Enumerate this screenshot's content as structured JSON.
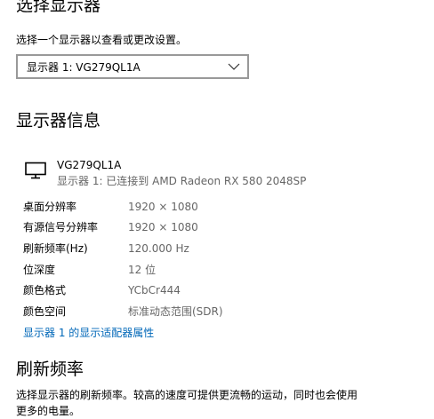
{
  "select_display": {
    "title": "选择显示器",
    "description": "选择一个显示器以查看或更改设置。",
    "dropdown_value": "显示器 1: VG279QL1A"
  },
  "display_info": {
    "title": "显示器信息",
    "monitor_name": "VG279QL1A",
    "monitor_connection": "显示器 1: 已连接到 AMD Radeon RX 580 2048SP",
    "rows": [
      {
        "label": "桌面分辨率",
        "value": "1920 × 1080"
      },
      {
        "label": "有源信号分辨率",
        "value": "1920 × 1080"
      },
      {
        "label": "刷新频率(Hz)",
        "value": "120.000 Hz"
      },
      {
        "label": "位深度",
        "value": "12 位"
      },
      {
        "label": "颜色格式",
        "value": "YCbCr444"
      },
      {
        "label": "颜色空间",
        "value": "标准动态范围(SDR)"
      }
    ],
    "adapter_link": "显示器 1 的显示适配器属性"
  },
  "refresh_rate": {
    "title": "刷新频率",
    "description_line1": "选择显示器的刷新频率。较高的速度可提供更流畅的运动，同时也会使用",
    "description_line2": "更多的电量。"
  },
  "icons": {
    "dropdown_chevron": "chevron-down-icon",
    "monitor": "monitor-icon"
  },
  "colors": {
    "link": "#0067b8",
    "secondary_text": "#666666",
    "border": "#999999"
  }
}
